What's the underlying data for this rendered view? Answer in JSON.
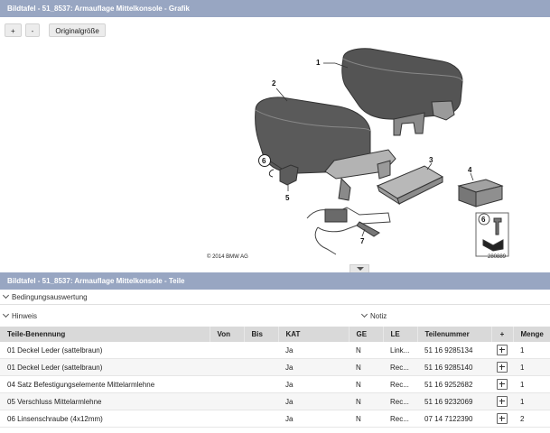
{
  "graphic_panel": {
    "title": "Bildtafel - 51_8537: Armauflage Mittelkonsole - Grafik",
    "toolbar": {
      "zoom_in": "+",
      "zoom_out": "-",
      "original_size": "Originalgröße"
    },
    "callouts": [
      "1",
      "2",
      "3",
      "4",
      "5",
      "6",
      "6",
      "7"
    ],
    "copyright": "© 2014 BMW AG",
    "image_number": "280889"
  },
  "parts_panel": {
    "title": "Bildtafel - 51_8537: Armauflage Mittelkonsole - Teile",
    "filters": {
      "conditions": "Bedingungsauswertung",
      "hint": "Hinweis",
      "note": "Notiz"
    },
    "columns": [
      "Teile-Benennung",
      "Von",
      "Bis",
      "KAT",
      "GE",
      "LE",
      "Teilenummer",
      "+",
      "Menge"
    ],
    "rows": [
      {
        "name": "01 Deckel Leder (sattelbraun)",
        "von": "",
        "bis": "",
        "kat": "Ja",
        "ge": "N",
        "le": "Link...",
        "part_no": "51 16 9285134",
        "qty": "1"
      },
      {
        "name": "01 Deckel Leder (sattelbraun)",
        "von": "",
        "bis": "",
        "kat": "Ja",
        "ge": "N",
        "le": "Rec...",
        "part_no": "51 16 9285140",
        "qty": "1"
      },
      {
        "name": "04 Satz Befestigungselemente Mittelarmlehne",
        "von": "",
        "bis": "",
        "kat": "Ja",
        "ge": "N",
        "le": "Rec...",
        "part_no": "51 16 9252682",
        "qty": "1"
      },
      {
        "name": "05 Verschluss Mittelarmlehne",
        "von": "",
        "bis": "",
        "kat": "Ja",
        "ge": "N",
        "le": "Rec...",
        "part_no": "51 16 9232069",
        "qty": "1"
      },
      {
        "name": "06 Linsenschraube (4x12mm)",
        "von": "",
        "bis": "",
        "kat": "Ja",
        "ge": "N",
        "le": "Rec...",
        "part_no": "07 14 7122390",
        "qty": "2"
      }
    ]
  }
}
